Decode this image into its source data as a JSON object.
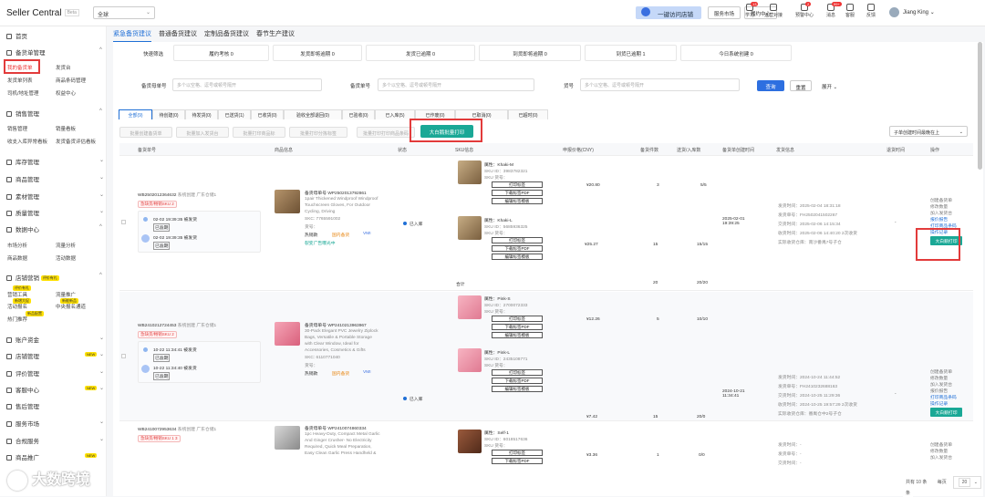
{
  "app": {
    "title": "Seller Central",
    "beta": "Beta",
    "region": "全球"
  },
  "topbar": {
    "onekey": "一键访问店铺",
    "service_market": "服务市场",
    "fulfill_center": "履约中心",
    "icons": [
      {
        "label": "学习",
        "badge": "13"
      },
      {
        "label": "运营对接",
        "badge": ""
      },
      {
        "label": "预警中心",
        "badge": "2"
      },
      {
        "label": "消息",
        "badge": "99+"
      },
      {
        "label": "客服",
        "badge": ""
      },
      {
        "label": "反馈",
        "badge": ""
      }
    ],
    "user": "Jiang King"
  },
  "sidebar": {
    "home": "首页",
    "stock_mgmt": "备货单管理",
    "stock_items": [
      "我的备货单",
      "发货台",
      "发货单列表",
      "商品条码管理",
      "司机/地址管理",
      "权益中心"
    ],
    "sales_mgmt": "销售管理",
    "sales_items": [
      "销售管理",
      "销量看板",
      "收支入库异常看板",
      "发货备货评估看板"
    ],
    "groups": [
      {
        "label": "库存管理"
      },
      {
        "label": "商品管理"
      },
      {
        "label": "素材管理"
      },
      {
        "label": "质量管理"
      },
      {
        "label": "数据中心"
      }
    ],
    "data_items": [
      "市场分析",
      "流量分析",
      "商品数据",
      "活动数据"
    ],
    "store_marketing": "店铺营销",
    "store_marketing_tag": "评价有礼",
    "marketing_items": [
      "营销工具",
      "流量推广",
      "活动报名",
      "中央报名通道",
      "热门推荐"
    ],
    "marketing_tags": [
      "评价有礼",
      "新增大促",
      "新能新品",
      "新品配置"
    ],
    "bottom_groups": [
      {
        "label": "账户资金",
        "badge": ""
      },
      {
        "label": "店铺管理",
        "badge": "NEW"
      },
      {
        "label": "评价管理",
        "badge": ""
      },
      {
        "label": "客服中心",
        "badge": "NEW"
      },
      {
        "label": "售后管理",
        "badge": ""
      },
      {
        "label": "服务市场",
        "badge": ""
      },
      {
        "label": "合规服务",
        "badge": ""
      },
      {
        "label": "商品推广",
        "badge": "NEW"
      }
    ]
  },
  "page_tabs": [
    "紧急备货建议",
    "普通备货建议",
    "定制品备货建议",
    "春节生产建议"
  ],
  "stats": [
    "履约考核 0",
    "发货即将逾期 0",
    "发货已逾期 0",
    "到货即将逾期 0",
    "到货已逾期 1",
    "今日系统创建 0"
  ],
  "quick_filter": "快速筛选",
  "search": {
    "order_label": "备货母单号",
    "order_ph": "多个以空格、逗号或顿号隔开",
    "sub_label": "备货单号",
    "sub_ph": "多个以空格、逗号或顿号隔开",
    "sku_label": "货号",
    "sku_ph": "多个以空格、逗号或顿号隔开",
    "query": "查询",
    "reset": "重置",
    "expand": "展开"
  },
  "status_tabs": [
    "全部(9)",
    "待创建(0)",
    "待发货(0)",
    "已送货(1)",
    "已收货(0)",
    "验收全部退回(0)",
    "已验收(0)",
    "已入库(5)",
    "已作废(0)",
    "已取消(0)",
    "已超时(0)"
  ],
  "actions": [
    "批量创建备货单",
    "批量加入发货台",
    "批量打印商品标",
    "批量打印分拣标签",
    "批量打印打印商品条码"
  ],
  "big_print": "大白鹅批量打印",
  "sort_select": "子单创建时间最晚在上",
  "columns": [
    "备货单号",
    "商品信息",
    "状态",
    "SKU信息",
    "申报价格(CNY)",
    "备货件数",
    "送货/入库数",
    "备货单创建时间",
    "发货信息",
    "退货时间",
    "操作"
  ],
  "rows": [
    {
      "order_id": "WB2502012364632",
      "origin": "系统创建",
      "site": "广东仓储1",
      "tag": "急缺货/畅销SKU 2",
      "t1": "02-02 19:39:35 被发货",
      "s1": "已逾期",
      "t2": "02-02 19:39:35 被发货",
      "s2": "已逾期",
      "prod_id": "备货母单号 WP2502013792861",
      "prod_desc": [
        "1pair Thickened Windproof Windproof",
        "Touchscreen Gloves, For Outdoor",
        "Cycling, Driving"
      ],
      "prod_sku": "SKC: 7765591002",
      "prod_no": "货号：",
      "tags": [
        "热销款",
        "国内备货",
        "VMI"
      ],
      "tag2": "裂变广告曝光中",
      "status": "已入库",
      "skus": [
        {
          "attr": "属性：Khaki-M",
          "skuid": "SKU ID：3983782321",
          "skuno": "SKU 货号：",
          "price": "¥20.80",
          "qty": "3",
          "recv": "5/5"
        },
        {
          "attr": "属性：Khaki-L",
          "skuid": "SKU ID：5685936325",
          "skuno": "SKU 货号：",
          "price": "¥25.27",
          "qty": "15",
          "recv": "15/15"
        }
      ],
      "total": "合计",
      "tot_qty": "20",
      "tot_recv": "20/20",
      "created": "2025-02-01 19:39:25",
      "ship": [
        "发货时间：2025-02-04 18:31:18",
        "发货单号：FH2502041502267",
        "交货时间：2025-02-06 14:15:34",
        "收货时间：2025-02-06 14:40:20 2次收货",
        "实际收货仓库：南沙番禺7号子仓"
      ],
      "refund": "-",
      "ops": [
        "创建备货单",
        "修改数量",
        "加入发货台",
        "报价报告",
        "打印商品条码",
        "操作记录"
      ],
      "op_btn": "大白鹅打印"
    },
    {
      "order_id": "WB2410212724453",
      "origin": "系统创建",
      "site": "广东仓储1",
      "tag": "急缺货/畅销SKU 2",
      "t1": "10-22 11:34:41 被发货",
      "s1": "已逾期",
      "t2": "10-22 11:34:40 被发货",
      "s2": "已逾期",
      "prod_id": "备货母单号 WP2410213963967",
      "prod_desc": [
        "30-Pack Elegant PVC Jewelry Ziplock",
        "Bags, Versatile & Portable Storage",
        "with Clear Window, Ideal for",
        "Accessories, Cosmetics & Gifts"
      ],
      "prod_sku": "SKC: 6110771040",
      "prod_no": "货号：",
      "tags": [
        "热销款",
        "国内备货",
        "VMI"
      ],
      "tag2": "",
      "status": "已入库",
      "skus": [
        {
          "attr": "属性：Pink-S",
          "skuid": "SKU ID：2700072333",
          "skuno": "SKU 货号：",
          "price": "¥12.26",
          "qty": "5",
          "recv": "10/10"
        },
        {
          "attr": "属性：Pink-L",
          "skuid": "SKU ID：2435108771",
          "skuno": "SKU 货号：",
          "price": "¥7.42",
          "qty": "15",
          "recv": "20/0"
        }
      ],
      "total": "合计",
      "tot_qty": "20",
      "tot_recv": "30/10",
      "created": "2024-10-21 11:34:41",
      "ship": [
        "发货时间：2024-10-24 11:44:52",
        "发货单号：FH2410232688163",
        "交货时间：2024-10-25 11:29:36",
        "收货时间：2024-10-25 19:57:29 2次收货",
        "实际收货仓库：番禺仓中2号子仓"
      ],
      "refund": "-",
      "ops": [
        "创建备货单",
        "修改数量",
        "加入发货台",
        "报价报告",
        "打印商品条码",
        "操作记录"
      ],
      "op_btn": "大白鹅打印"
    },
    {
      "order_id": "WB2410072953634",
      "origin": "系统创建",
      "site": "广东仓储1",
      "tag": "急缺货/畅销SKU 1 3",
      "prod_id": "备货母单号 WP2410074860334",
      "prod_desc": [
        "1pc Heavy-Duty, Compact Metal Garlic",
        "And Ginger Crusher- No Electricity",
        "Required, Quick Meal Preparation,",
        "Easy Clean Garlic Press Handheld &"
      ],
      "skus": [
        {
          "attr": "属性：Self-1",
          "skuid": "SKU ID：6018517636",
          "skuno": "SKU 货号：",
          "price": "¥3.36",
          "qty": "1",
          "recv": "0/0"
        }
      ],
      "ship": [
        "发货时间：-",
        "发货单号：-",
        "交货时间：-"
      ],
      "ops": [
        "创建备货单",
        "修改数量",
        "加入发货台"
      ]
    }
  ],
  "print_label": "打印标签",
  "pdf_label": "下载标签PDF",
  "tmpl_label": "编辑标签模板",
  "pager": {
    "total": "共有 10 条",
    "pages": "每页",
    "page_size": "20",
    "unit": "条"
  },
  "watermark": "大数跨境"
}
